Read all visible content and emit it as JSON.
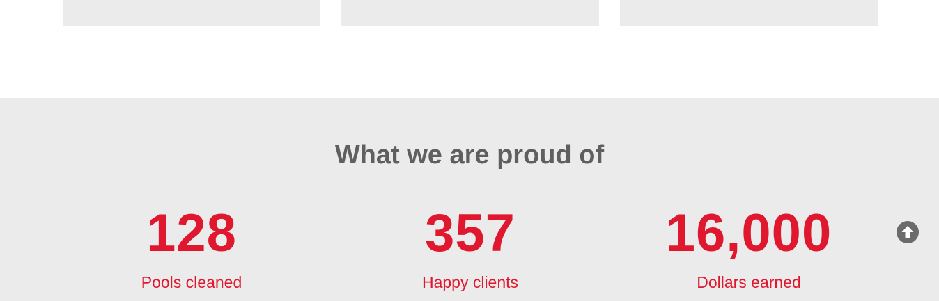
{
  "stats_section": {
    "title": "What we are proud of",
    "items": [
      {
        "number": "128",
        "label": "Pools cleaned"
      },
      {
        "number": "357",
        "label": "Happy clients"
      },
      {
        "number": "16,000",
        "label": "Dollars earned"
      }
    ]
  },
  "icons": {
    "scroll_top": "arrow-up-circle-icon"
  },
  "colors": {
    "accent": "#e0182f",
    "heading": "#5f5f5f",
    "section_bg": "#ebebeb",
    "card_bg": "#ebebeb",
    "icon": "#6b6b6b"
  }
}
